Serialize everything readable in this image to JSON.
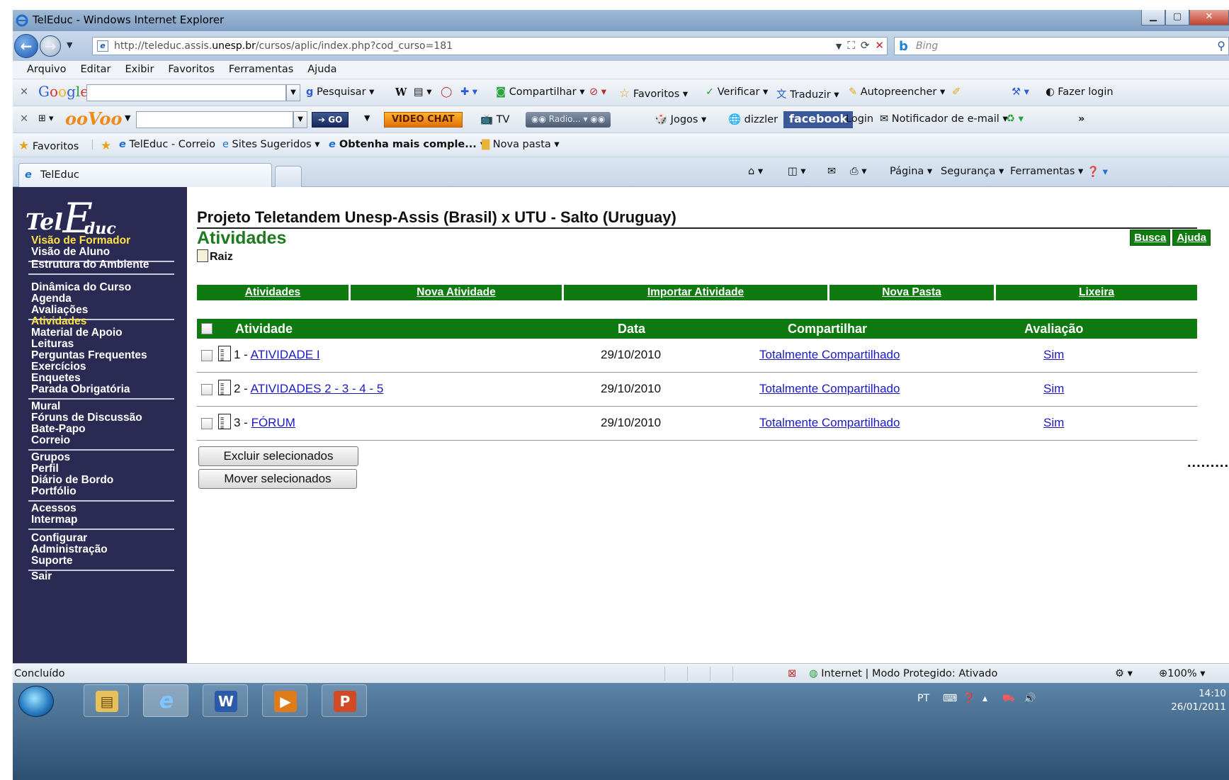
{
  "window": {
    "title": "TelEduc - Windows Internet Explorer"
  },
  "address": {
    "url_pre": "http://teleduc.assis.",
    "url_domain": "unesp.br",
    "url_post": "/cursos/aplic/index.php?cod_curso=181",
    "search_placeholder": "Bing"
  },
  "menu": [
    "Arquivo",
    "Editar",
    "Exibir",
    "Favoritos",
    "Ferramentas",
    "Ajuda"
  ],
  "google_toolbar": {
    "search": "Pesquisar",
    "share": "Compartilhar",
    "favorites": "Favoritos",
    "verify": "Verificar",
    "translate": "Traduzir",
    "autofill": "Autopreencher",
    "login": "Fazer login"
  },
  "oovoo_toolbar": {
    "go": "GO",
    "video_chat": "VIDEO CHAT",
    "tv": "TV",
    "radio": "Radio...",
    "games": "Jogos",
    "facebook": "facebook",
    "login": "Login",
    "mail": "Notificador de e-mail",
    "more": "»"
  },
  "favorites_bar": {
    "favorites": "Favoritos",
    "correio": "TelEduc - Correio",
    "sugeridos": "Sites Sugeridos",
    "obtenha": "Obtenha mais comple...",
    "nova_pasta": "Nova pasta"
  },
  "tab": {
    "label": "TelEduc"
  },
  "command_bar": {
    "pagina": "Página",
    "seguranca": "Segurança",
    "ferramentas": "Ferramentas"
  },
  "sidebar": {
    "logo": {
      "tel": "Tel",
      "e": "E",
      "duc": "duc"
    },
    "groups": [
      {
        "items": [
          "Visão de Formador",
          "Visão de Aluno"
        ],
        "highlight": 0
      },
      {
        "items": [
          "Estrutura do Ambiente"
        ],
        "highlight": -1
      },
      {
        "items": [
          "Dinâmica do Curso",
          "Agenda",
          "Avaliações"
        ],
        "highlight": -1
      },
      {
        "items": [
          "Atividades",
          "Material de Apoio",
          "Leituras",
          "Perguntas Frequentes",
          "Exercícios",
          "Enquetes",
          "Parada Obrigatória"
        ],
        "highlight": 0
      },
      {
        "items": [
          "Mural",
          "Fóruns de Discussão",
          "Bate-Papo",
          "Correio"
        ],
        "highlight": -1
      },
      {
        "items": [
          "Grupos",
          "Perfil",
          "Diário de Bordo",
          "Portfólio"
        ],
        "highlight": -1
      },
      {
        "items": [
          "Acessos",
          "Intermap"
        ],
        "highlight": -1
      },
      {
        "items": [
          "Configurar",
          "Administração",
          "Suporte"
        ],
        "highlight": -1
      },
      {
        "items": [
          "Sair"
        ],
        "highlight": -1
      }
    ]
  },
  "main": {
    "course_title": "Projeto Teletandem Unesp-Assis (Brasil) x UTU - Salto (Uruguay)",
    "section_title": "Atividades",
    "busca": "Busca",
    "ajuda": "Ajuda",
    "raiz": "Raiz",
    "actions": [
      "Atividades",
      "Nova Atividade",
      "Importar Atividade",
      "Nova Pasta",
      "Lixeira"
    ],
    "columns": {
      "atividade": "Atividade",
      "data": "Data",
      "compartilhar": "Compartilhar",
      "avaliacao": "Avaliação"
    },
    "rows": [
      {
        "num": "1 - ",
        "name": "ATIVIDADE I",
        "date": "29/10/2010",
        "share": "Totalmente Compartilhado",
        "aval": "Sim"
      },
      {
        "num": "2 - ",
        "name": "ATIVIDADES 2 - 3 - 4 - 5",
        "date": "29/10/2010",
        "share": "Totalmente Compartilhado",
        "aval": "Sim"
      },
      {
        "num": "3 - ",
        "name": "FÓRUM",
        "date": "29/10/2010",
        "share": "Totalmente Compartilhado",
        "aval": "Sim"
      }
    ],
    "btn_delete": "Excluir selecionados",
    "btn_move": "Mover selecionados",
    "dots": "........."
  },
  "status": {
    "text": "Concluído",
    "zone": "Internet | Modo Protegido: Ativado",
    "zoom": "100%"
  },
  "taskbar": {
    "lang": "PT",
    "time": "14:10",
    "date": "26/01/2011"
  },
  "colors": {
    "sidebar": "#2a2a52",
    "green": "#0f7a0f",
    "highlight": "#ffe14a",
    "link": "#1a1ac0"
  }
}
